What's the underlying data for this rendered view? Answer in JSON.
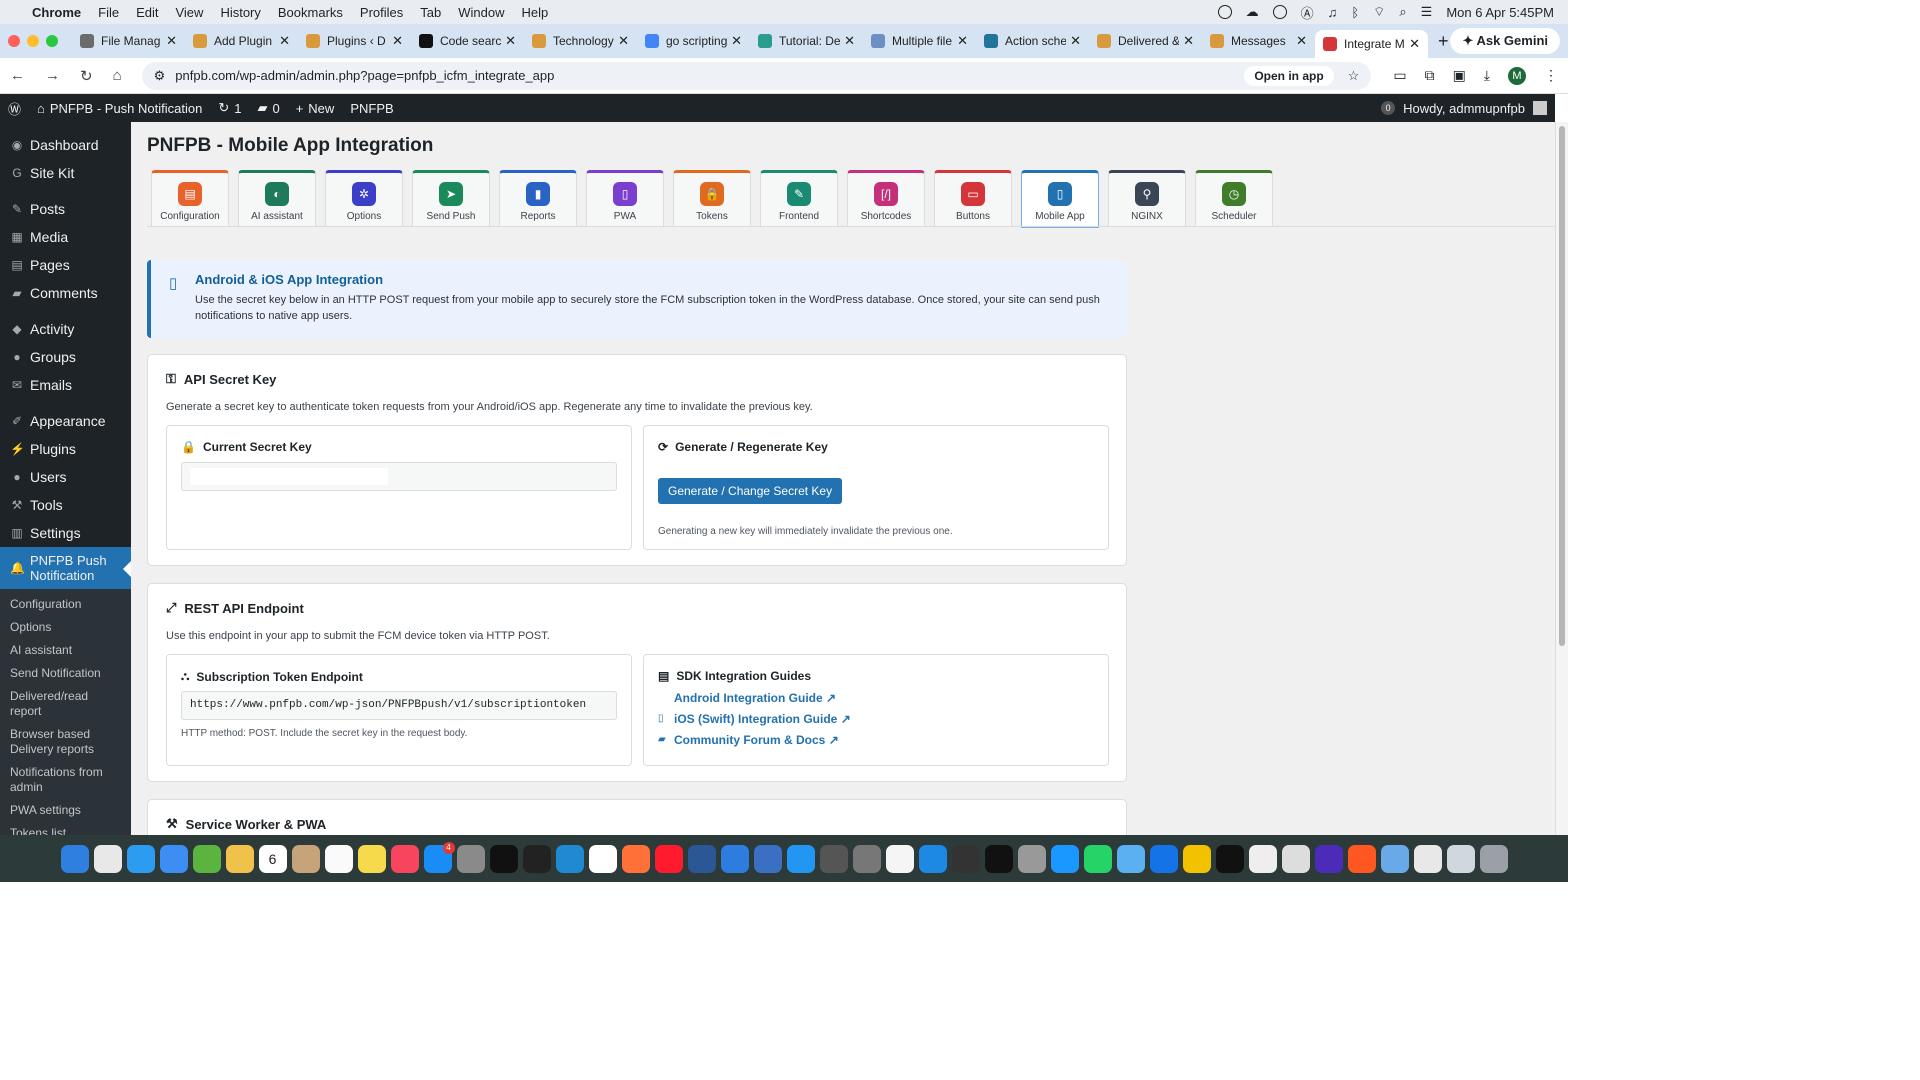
{
  "menubar": {
    "app": "Chrome",
    "items": [
      "File",
      "Edit",
      "View",
      "History",
      "Bookmarks",
      "Profiles",
      "Tab",
      "Window",
      "Help"
    ],
    "datetime": "Mon 6 Apr  5:45PM"
  },
  "tabs": [
    {
      "title": "File Manag",
      "favicon_color": "#6b6b6b"
    },
    {
      "title": "Add Plugin",
      "favicon_color": "#d89a3c"
    },
    {
      "title": "Plugins ‹ D",
      "favicon_color": "#d89a3c"
    },
    {
      "title": "Code searc",
      "favicon_color": "#111111"
    },
    {
      "title": "Technology",
      "favicon_color": "#d89a3c"
    },
    {
      "title": "go scripting",
      "favicon_color": "#4285f4"
    },
    {
      "title": "Tutorial: De",
      "favicon_color": "#2a9d8f"
    },
    {
      "title": "Multiple file",
      "favicon_color": "#6b8fc2"
    },
    {
      "title": "Action sche",
      "favicon_color": "#21759b"
    },
    {
      "title": "Delivered &",
      "favicon_color": "#d89a3c"
    },
    {
      "title": "Messages",
      "favicon_color": "#d89a3c"
    },
    {
      "title": "Integrate M",
      "favicon_color": "#d63638"
    }
  ],
  "new_tab": "+",
  "ask_gemini": "Ask Gemini",
  "address": {
    "url": "pnfpb.com/wp-admin/admin.php?page=pnfpb_icfm_integrate_app",
    "open_in_app": "Open in app",
    "profile": "M"
  },
  "adminbar": {
    "site": "PNFPB - Push Notification",
    "updates": "1",
    "comments": "0",
    "new": "New",
    "plugin": "PNFPB",
    "notif_count": "0",
    "howdy": "Howdy, admmupnfpb"
  },
  "sidebar": {
    "groups": [
      [
        {
          "label": "Dashboard",
          "icon": "dashboard-icon"
        },
        {
          "label": "Site Kit",
          "icon": "sitekit-icon"
        }
      ],
      [
        {
          "label": "Posts",
          "icon": "pin-icon"
        },
        {
          "label": "Media",
          "icon": "media-icon"
        },
        {
          "label": "Pages",
          "icon": "page-icon"
        },
        {
          "label": "Comments",
          "icon": "comment-icon"
        }
      ],
      [
        {
          "label": "Activity",
          "icon": "activity-icon"
        },
        {
          "label": "Groups",
          "icon": "groups-icon"
        },
        {
          "label": "Emails",
          "icon": "email-icon"
        }
      ],
      [
        {
          "label": "Appearance",
          "icon": "brush-icon"
        },
        {
          "label": "Plugins",
          "icon": "plugin-icon"
        },
        {
          "label": "Users",
          "icon": "user-icon"
        },
        {
          "label": "Tools",
          "icon": "wrench-icon"
        },
        {
          "label": "Settings",
          "icon": "settings-icon"
        }
      ]
    ],
    "current": "PNFPB Push Notification",
    "submenu": [
      "Configuration",
      "Options",
      "AI assistant",
      "Send Notification",
      "Delivered/read report",
      "Browser based Delivery reports",
      "Notifications from admin",
      "PWA settings",
      "Tokens list"
    ]
  },
  "page": {
    "title": "PNFPB - Mobile App Integration",
    "tabs": [
      {
        "label": "Configuration",
        "color": "#e8622c",
        "glyph": "▤"
      },
      {
        "label": "AI assistant",
        "color": "#1f7a5c",
        "glyph": "◐"
      },
      {
        "label": "Options",
        "color": "#3b3fc7",
        "glyph": "✲"
      },
      {
        "label": "Send Push",
        "color": "#1b8a5a",
        "glyph": "➤"
      },
      {
        "label": "Reports",
        "color": "#2a63c4",
        "glyph": "▮"
      },
      {
        "label": "PWA",
        "color": "#7a3fcf",
        "glyph": "▯"
      },
      {
        "label": "Tokens",
        "color": "#e06a1f",
        "glyph": "🔒"
      },
      {
        "label": "Frontend",
        "color": "#1a8a73",
        "glyph": "✎"
      },
      {
        "label": "Shortcodes",
        "color": "#c5307a",
        "glyph": "[/]"
      },
      {
        "label": "Buttons",
        "color": "#d4353a",
        "glyph": "▭"
      },
      {
        "label": "Mobile App",
        "color": "#2271b1",
        "glyph": "▯"
      },
      {
        "label": "NGINX",
        "color": "#3a4556",
        "glyph": "⚲"
      },
      {
        "label": "Scheduler",
        "color": "#3f7d2a",
        "glyph": "◷"
      }
    ],
    "active_tab": "Mobile App",
    "banner": {
      "title": "Android & iOS App Integration",
      "text": "Use the secret key below in an HTTP POST request from your mobile app to securely store the FCM subscription token in the WordPress database. Once stored, your site can send push notifications to native app users."
    },
    "secret": {
      "heading": "API Secret Key",
      "desc": "Generate a secret key to authenticate token requests from your Android/iOS app. Regenerate any time to invalidate the previous key.",
      "current_label": "Current Secret Key",
      "current_value": "",
      "gen_label": "Generate / Regenerate Key",
      "gen_button": "Generate / Change Secret Key",
      "gen_note": "Generating a new key will immediately invalidate the previous one."
    },
    "rest": {
      "heading": "REST API Endpoint",
      "desc": "Use this endpoint in your app to submit the FCM device token via HTTP POST.",
      "endpoint_label": "Subscription Token Endpoint",
      "endpoint": "https://www.pnfpb.com/wp-json/PNFPBpush/v1/subscriptiontoken",
      "endpoint_note": "HTTP method: POST. Include the secret key in the request body.",
      "sdk_label": "SDK Integration Guides",
      "links": [
        "Android Integration Guide",
        "iOS (Swift) Integration Guide",
        "Community Forum & Docs"
      ]
    },
    "sw_heading": "Service Worker & PWA"
  },
  "dock": {
    "calendar_day": "6",
    "appstore_badge": "4"
  }
}
